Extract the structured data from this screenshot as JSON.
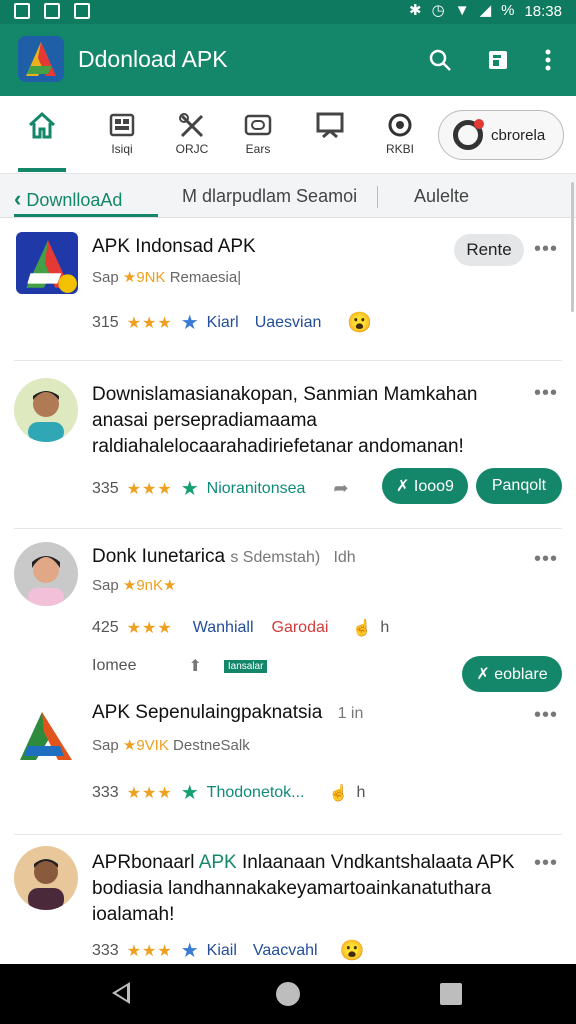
{
  "status": {
    "time": "18:38",
    "battery": "%"
  },
  "appbar": {
    "title": "Ddonload APK"
  },
  "categories": [
    {
      "label": "",
      "icon": "home-icon"
    },
    {
      "label": "Isiqi",
      "icon": "grid-icon"
    },
    {
      "label": "ORJC",
      "icon": "tools-icon"
    },
    {
      "label": "Ears",
      "icon": "camera-icon"
    },
    {
      "label": "",
      "icon": "monitor-icon"
    },
    {
      "label": "RKBI",
      "icon": "record-icon"
    }
  ],
  "category_pill": {
    "label": "cbrorela"
  },
  "tabs": [
    {
      "label": "DownlloaAd"
    },
    {
      "label": "M dlarpudlam Seamoi"
    },
    {
      "label": "Aulelte"
    }
  ],
  "items": [
    {
      "title": "APK Indonsad APK",
      "subtitle": "Sap",
      "subtitle_tag": "★9NK",
      "subtitle_rest": "Remaesia|",
      "count": "315",
      "stars": "★★★",
      "link1": "Kiarl",
      "link2": "Uaesvian",
      "button": "Rente"
    },
    {
      "title": "Downislamasianakopan, Sanmian Mamkahan anasai persepradiamaama raldiahalelocaarahadiriefetanar andomanan!",
      "count": "335",
      "stars": "★★★",
      "link1": "Nioranitonsea",
      "button1": "✗ Iooo9",
      "button2": "Panqolt"
    },
    {
      "title": "Donk Iunetarica",
      "title_rest": "s Sdemstah)",
      "time": "Idh",
      "subtitle": "Sap",
      "subtitle_tag": "★9nK★",
      "count": "425",
      "stars": "★★★",
      "link1": "Wanhiall",
      "link2": "Garodai",
      "like_count": "h",
      "extra_label": "Iomee",
      "tag": "Iansalar",
      "button": "✗ eoblare"
    },
    {
      "title": "APK Sepenulaingpaknatsia",
      "time": "1 in",
      "subtitle": "Sap",
      "subtitle_tag": "★9VIK",
      "subtitle_rest": "DestneSalk",
      "count": "333",
      "stars": "★★★",
      "link1": "Thodonetok...",
      "like_count": "h"
    },
    {
      "title_a": "APRbonaarl",
      "title_green": "APK",
      "title_b": "Inlaanaan Vndkantshalaata APK bodiasia landhannakakeyamartoainkanatuthara ioalamah!",
      "count": "333",
      "stars": "★★★",
      "link1": "Kiail",
      "link2": "Vaacvahl"
    }
  ]
}
